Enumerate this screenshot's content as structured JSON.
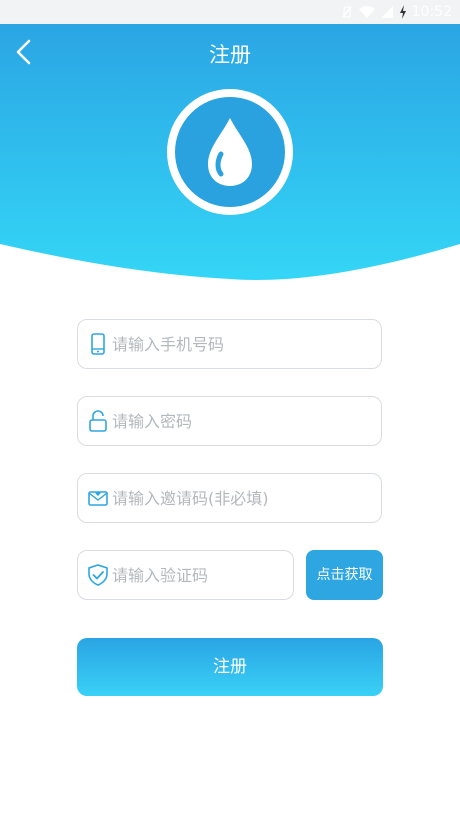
{
  "status_bar": {
    "time": "10:52"
  },
  "header": {
    "title": "注册"
  },
  "form": {
    "phone_placeholder": "请输入手机号码",
    "password_placeholder": "请输入密码",
    "invite_placeholder": "请输入邀请码(非必填)",
    "code_placeholder": "请输入验证码",
    "get_code_label": "点击获取",
    "submit_label": "注册"
  },
  "colors": {
    "gradient_top": "#2ba5e4",
    "gradient_bottom": "#34d6f6",
    "accent": "#2ea6e2",
    "icon": "#2ea6e2"
  },
  "icons": [
    "back-arrow-icon",
    "water-drop-icon",
    "phone-icon",
    "lock-icon",
    "envelope-icon",
    "shield-check-icon"
  ]
}
